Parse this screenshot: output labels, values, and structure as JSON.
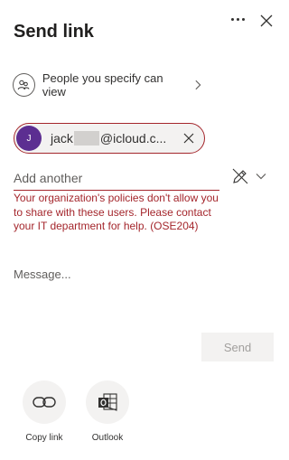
{
  "dialog": {
    "title": "Send link"
  },
  "permission": {
    "label": "People you specify can view"
  },
  "recipient": {
    "initial": "J",
    "name_prefix": "jack",
    "name_suffix": "@icloud.c..."
  },
  "add_field": {
    "placeholder": "Add another"
  },
  "error": {
    "text": "Your organization's policies don't allow you to share with these users. Please contact your IT department for help. (OSE204)"
  },
  "message": {
    "placeholder": "Message..."
  },
  "send_button": {
    "label": "Send"
  },
  "share_options": [
    {
      "label": "Copy link",
      "icon": "link-icon"
    },
    {
      "label": "Outlook",
      "icon": "outlook-icon"
    }
  ],
  "colors": {
    "error": "#a4262c",
    "avatar": "#5c2e91",
    "chip_bg": "#f3f2f1",
    "disabled_text": "#a19f9d"
  }
}
